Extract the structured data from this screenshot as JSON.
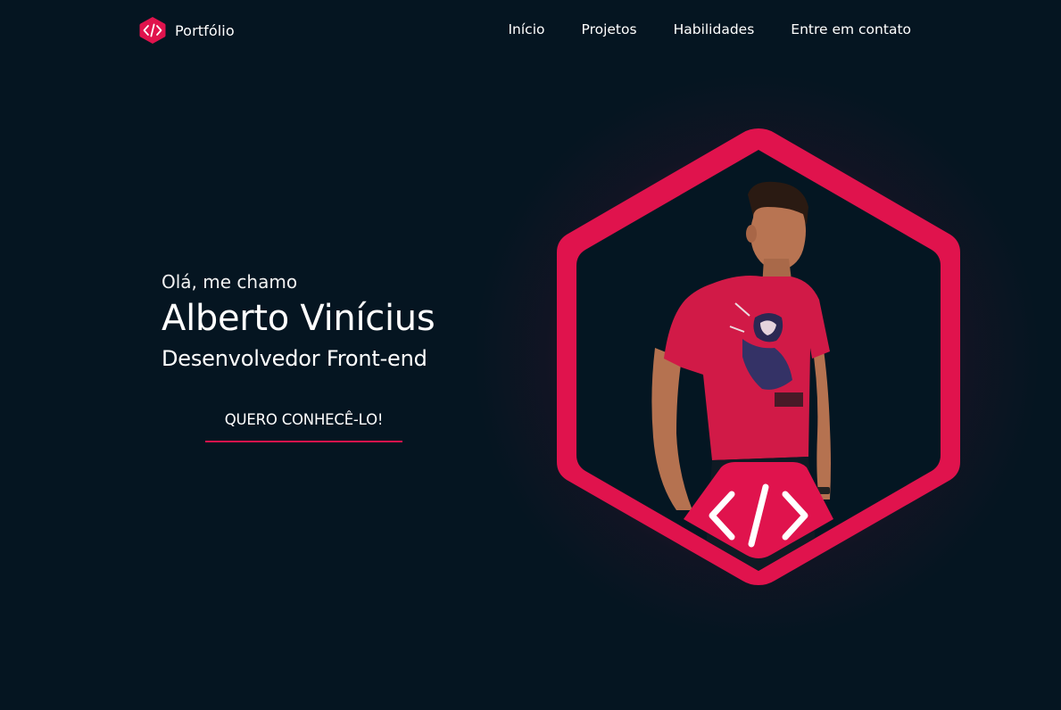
{
  "header": {
    "brand_label": "Portfólio",
    "nav": [
      {
        "label": "Início"
      },
      {
        "label": "Projetos"
      },
      {
        "label": "Habilidades"
      },
      {
        "label": "Entre em contato"
      }
    ]
  },
  "hero": {
    "greeting": "Olá, me chamo",
    "name": "Alberto Vinícius",
    "role": "Desenvolvedor Front-end",
    "cta_label": "QUERO CONHECÊ-LO!"
  },
  "icons": {
    "brand": "code-icon",
    "badge": "code-icon"
  },
  "colors": {
    "background": "#051521",
    "accent": "#e0134d",
    "text": "#ffffff"
  }
}
